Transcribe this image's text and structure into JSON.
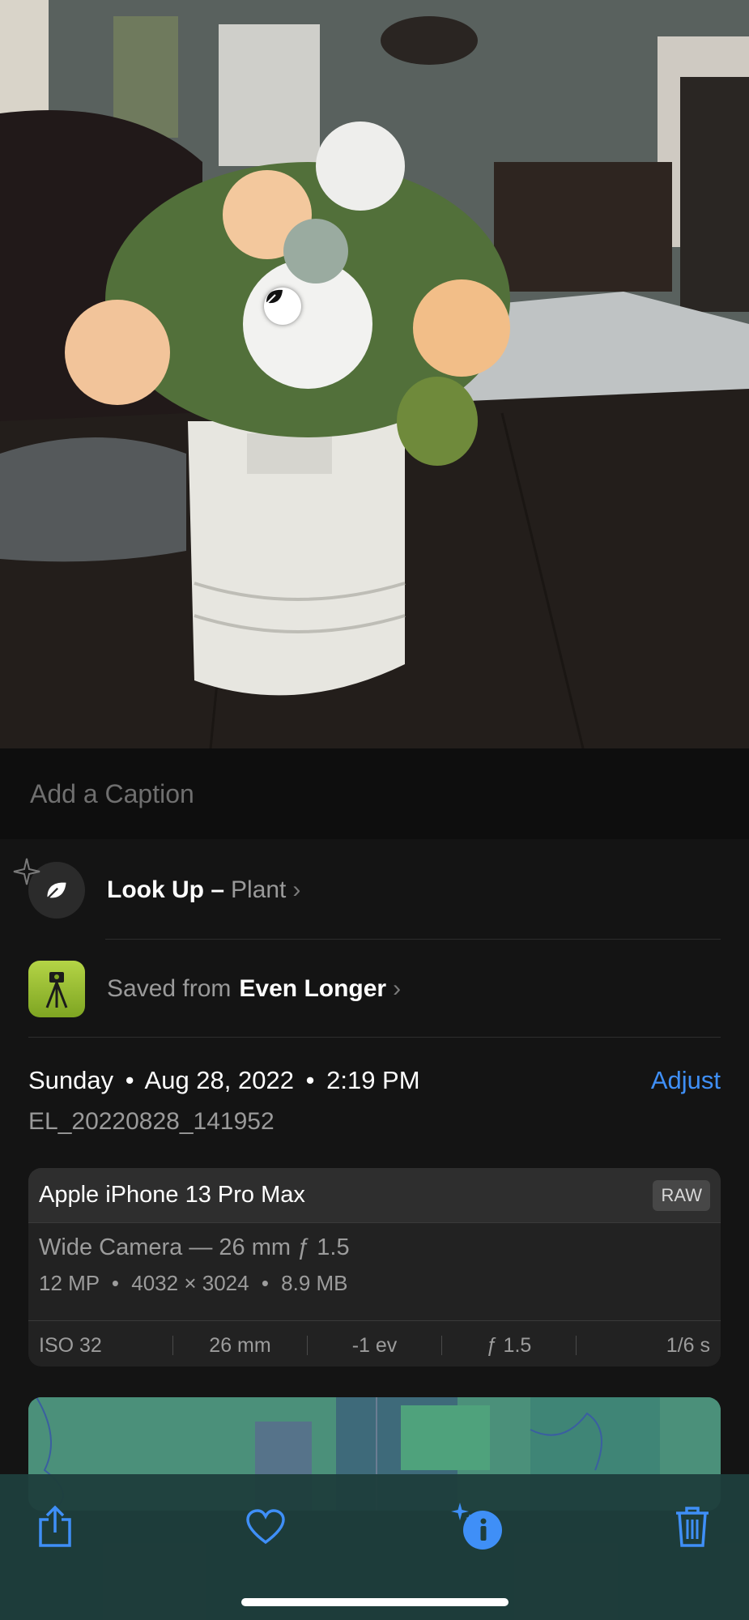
{
  "caption": {
    "placeholder": "Add a Caption"
  },
  "lookup": {
    "label": "Look Up –",
    "subject": "Plant"
  },
  "saved_from": {
    "prefix": "Saved from",
    "app": "Even Longer"
  },
  "date": {
    "day": "Sunday",
    "date": "Aug 28, 2022",
    "time": "2:19 PM",
    "adjust_label": "Adjust"
  },
  "filename": "EL_20220828_141952",
  "metadata": {
    "device": "Apple iPhone 13 Pro Max",
    "format_badge": "RAW",
    "lens": "Wide Camera — 26 mm ƒ 1.5",
    "specs": [
      "12 MP",
      "4032 × 3024",
      "8.9 MB"
    ],
    "exif": [
      "ISO 32",
      "26 mm",
      "-1 ev",
      "ƒ 1.5",
      "1/6 s"
    ]
  },
  "toolbar": {
    "icons": [
      "share-icon",
      "heart-icon",
      "info-sparkle-icon",
      "trash-icon"
    ],
    "accent": "#3f8ff7"
  },
  "colors": {
    "accent": "#3f8ff7",
    "background": "#141414"
  }
}
